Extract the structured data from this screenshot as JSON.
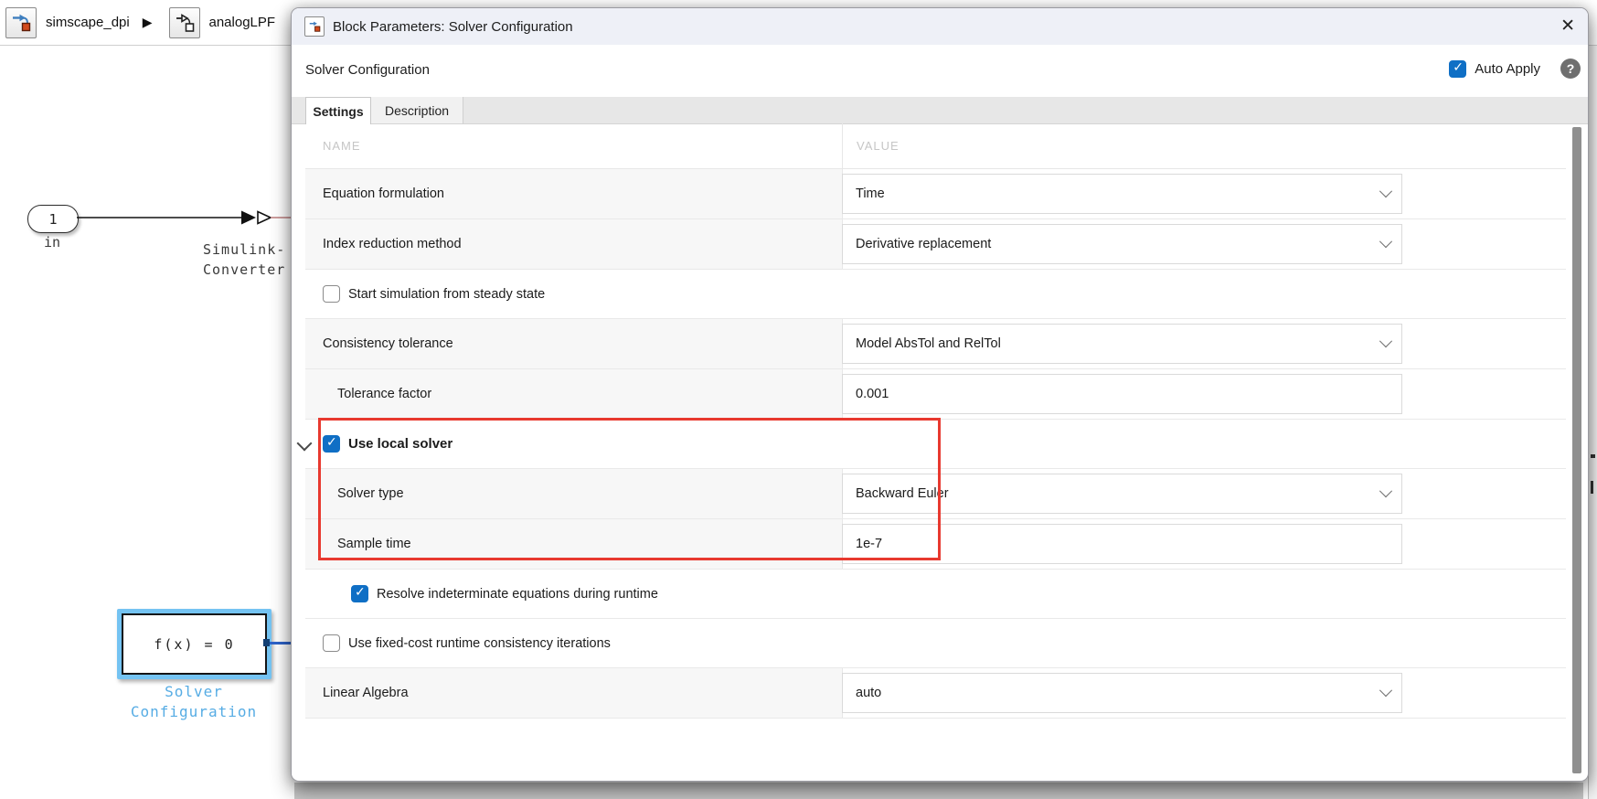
{
  "breadcrumb": {
    "separator_icon": "▶",
    "items": [
      {
        "label": "simscape_dpi",
        "icon": "simulink-model-icon"
      },
      {
        "label": "analogLPF",
        "icon": "simulink-subsystem-icon"
      }
    ]
  },
  "canvas": {
    "inport_block": {
      "port_number": "1",
      "name_label": "in"
    },
    "converter_block_label": {
      "line1": "Simulink-",
      "line2": "Converter"
    },
    "solver_block": {
      "block_text": "f(x) = 0",
      "name_label_line1": "Solver",
      "name_label_line2": "Configuration"
    }
  },
  "dialog": {
    "title": "Block Parameters: Solver Configuration",
    "close_icon": "✕",
    "header": {
      "block_name": "Solver Configuration",
      "auto_apply": {
        "label": "Auto Apply",
        "checked": true
      },
      "help_icon": "?"
    },
    "tabs": [
      {
        "label": "Settings",
        "active": true
      },
      {
        "label": "Description",
        "active": false
      }
    ],
    "table": {
      "columns": [
        "NAME",
        "VALUE"
      ],
      "rows": [
        {
          "name": "Equation formulation",
          "value": "Time",
          "control": "dropdown"
        },
        {
          "name": "Index reduction method",
          "value": "Derivative replacement",
          "control": "dropdown"
        },
        {
          "name": "Start simulation from steady state",
          "control": "checkbox",
          "checked": false
        },
        {
          "name": "Consistency tolerance",
          "value": "Model AbsTol and RelTol",
          "control": "dropdown"
        },
        {
          "name": "Tolerance factor",
          "value": "0.001",
          "control": "edit"
        },
        {
          "name": "Use local solver",
          "control": "section-checkbox",
          "checked": true,
          "expanded": true,
          "highlighted": true
        },
        {
          "name": "Solver type",
          "value": "Backward Euler",
          "control": "dropdown",
          "highlighted": true
        },
        {
          "name": "Sample time",
          "value": "1e-7",
          "control": "edit",
          "highlighted": true
        },
        {
          "name": "Resolve indeterminate equations during runtime",
          "control": "checkbox",
          "checked": true
        },
        {
          "name": "Use fixed-cost runtime consistency iterations",
          "control": "checkbox",
          "checked": false
        },
        {
          "name": "Linear Algebra",
          "value": "auto",
          "control": "dropdown"
        }
      ]
    }
  },
  "colors": {
    "accent_blue": "#0f6fc5",
    "annotation_red": "#e8392f",
    "selection_blue": "#74c3f2",
    "canvas_label_blue": "#56ace4",
    "wire_red": "#bc7d7d"
  }
}
